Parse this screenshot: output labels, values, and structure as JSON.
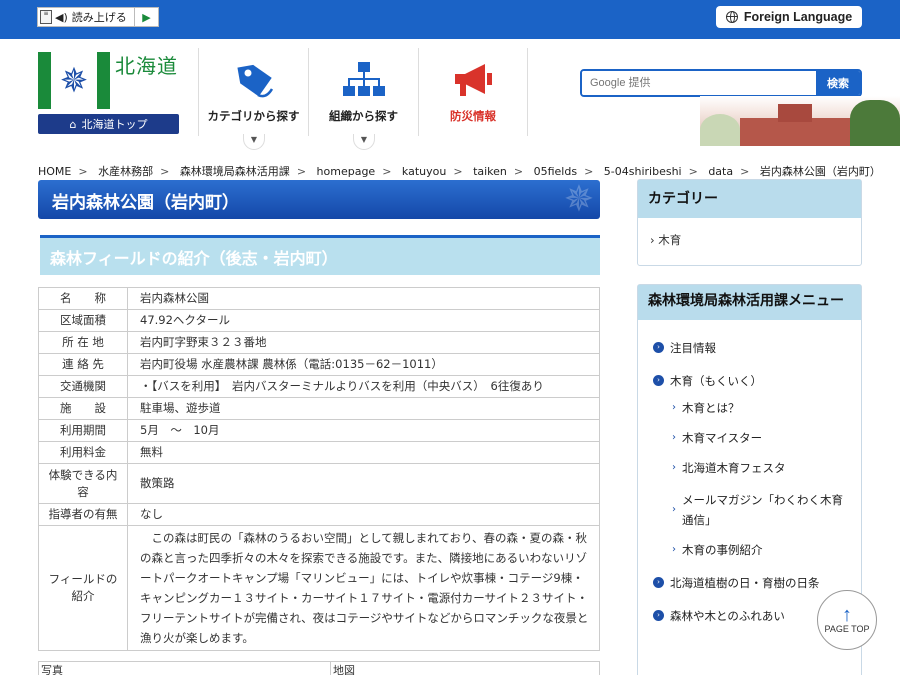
{
  "topbar": {
    "read_aloud_label": "読み上げる",
    "foreign_language_label": "Foreign Language"
  },
  "header": {
    "logo_text": "北海道",
    "home_link_label": "北海道トップ",
    "nav": [
      {
        "label": "カテゴリから探す",
        "icon": "tag-icon",
        "color": "#1b63c6"
      },
      {
        "label": "組織から探す",
        "icon": "org-chart-icon",
        "color": "#1b63c6"
      },
      {
        "label": "防災情報",
        "icon": "megaphone-icon",
        "color": "#d9332b"
      }
    ],
    "search": {
      "placeholder": "Google 提供",
      "button_label": "検索"
    }
  },
  "breadcrumb": [
    "HOME",
    "水産林務部",
    "森林環境局森林活用課",
    "homepage",
    "katuyou",
    "taiken",
    "05fields",
    "5-04shiribeshi",
    "data",
    "岩内森林公園（岩内町）"
  ],
  "main": {
    "title": "岩内森林公園（岩内町）",
    "subtitle": "森林フィールドの紹介（後志・岩内町）",
    "rows": [
      {
        "h": "名　　称",
        "v": "岩内森林公園"
      },
      {
        "h": "区域面積",
        "v": "47.92ヘクタール"
      },
      {
        "h": "所 在 地",
        "v": "岩内町字野束３２３番地"
      },
      {
        "h": "連 絡 先",
        "v": "岩内町役場 水産農林課 農林係（電話:0135－62－1011）"
      },
      {
        "h": "交通機関",
        "v": "・【バスを利用】　岩内バスターミナルよりバスを利用（中央バス）　6往復あり"
      },
      {
        "h": "施　　設",
        "v": "駐車場、遊歩道"
      },
      {
        "h": "利用期間",
        "v": "5月　～　10月"
      },
      {
        "h": "利用料金",
        "v": "無料"
      },
      {
        "h": "体験できる内容",
        "v": "散策路"
      },
      {
        "h": "指導者の有無",
        "v": "なし"
      },
      {
        "h": "フィールドの紹介",
        "v": "この森は町民の「森林のうるおい空間」として親しまれており、春の森・夏の森・秋の森と言った四季折々の木々を探索できる施設です。また、隣接地にあるいわないリゾートパークオートキャンプ場「マリンビュー」には、トイレや炊事棟・コテージ9棟・キャンピングカー１３サイト・カーサイト１７サイト・電源付カーサイト２３サイト・フリーテントサイトが完備され、夜はコテージやサイトなどからロマンチックな夜景と漁り火が楽しめます。"
      }
    ],
    "photo_header": [
      "写真",
      "地図"
    ]
  },
  "sidebar": {
    "category_title": "カテゴリー",
    "category_item": "木育",
    "menu_title": "森林環境局森林活用課メニュー",
    "menu": [
      {
        "label": "注目情報",
        "level": 1
      },
      {
        "label": "木育（もくいく）",
        "level": 1
      },
      {
        "label": "木育とは？",
        "level": 2
      },
      {
        "label": "木育マイスター",
        "level": 2
      },
      {
        "label": "北海道木育フェスタ",
        "level": 2
      },
      {
        "label": "メールマガジン「わくわく木育通信」",
        "level": 2
      },
      {
        "label": "木育の事例紹介",
        "level": 2
      },
      {
        "label": "北海道植樹の日・育樹の日条",
        "level": 1
      },
      {
        "label": "森林や木とのふれあい",
        "level": 1
      }
    ]
  },
  "page_top_label": "PAGE TOP"
}
